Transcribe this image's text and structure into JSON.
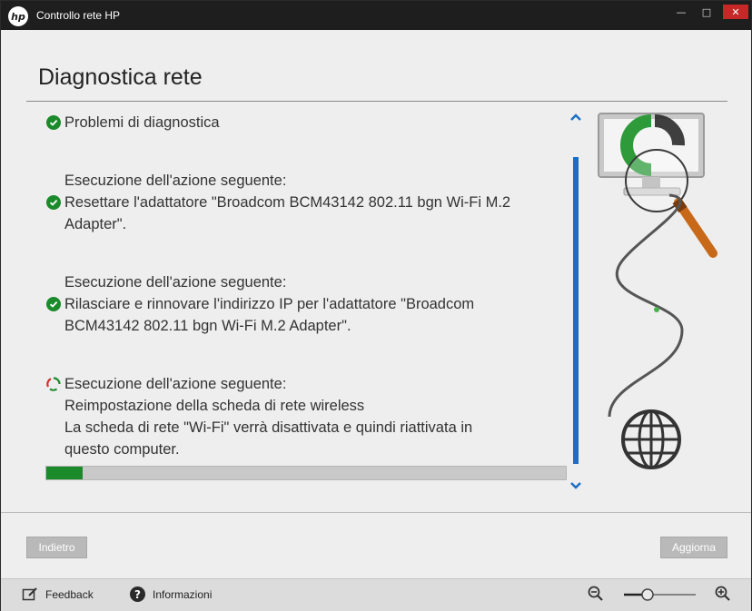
{
  "window": {
    "title": "Controllo rete HP",
    "logo_text": "hp",
    "controls": {
      "minimize": "—",
      "maximize": "□",
      "close": "✕"
    }
  },
  "page": {
    "title": "Diagnostica rete"
  },
  "steps": [
    {
      "status": "done",
      "lines": [
        "Problemi di diagnostica"
      ]
    },
    {
      "status": "done",
      "heading": "Esecuzione dell'azione seguente:",
      "lines": [
        "Resettare l'adattatore \"Broadcom BCM43142 802.11 bgn Wi-Fi M.2",
        "Adapter\"."
      ]
    },
    {
      "status": "done",
      "heading": "Esecuzione dell'azione seguente:",
      "lines": [
        "Rilasciare e rinnovare l'indirizzo IP per l'adattatore \"Broadcom",
        "BCM43142 802.11 bgn Wi-Fi M.2 Adapter\"."
      ]
    },
    {
      "status": "running",
      "heading": "Esecuzione dell'azione seguente:",
      "lines": [
        "Reimpostazione della scheda di rete wireless",
        "La scheda di rete \"Wi-Fi\" verrà disattivata e quindi riattivata in",
        "questo computer."
      ]
    }
  ],
  "progress": {
    "percent": 7
  },
  "buttons": {
    "back": "Indietro",
    "refresh": "Aggiorna"
  },
  "statusbar": {
    "feedback": "Feedback",
    "info": "Informazioni"
  },
  "zoom": {
    "level": 0.3
  },
  "icons": {
    "check": "check-circle-icon",
    "spinner": "spinner-icon",
    "feedback": "feedback-icon",
    "info": "info-icon",
    "zoom_out": "zoom-out-icon",
    "zoom_in": "zoom-in-icon"
  },
  "colors": {
    "accent_green": "#1b8a2b",
    "scroll_blue": "#1b6ec2",
    "title_bar": "#1e1e1e",
    "close_red": "#c62828"
  }
}
